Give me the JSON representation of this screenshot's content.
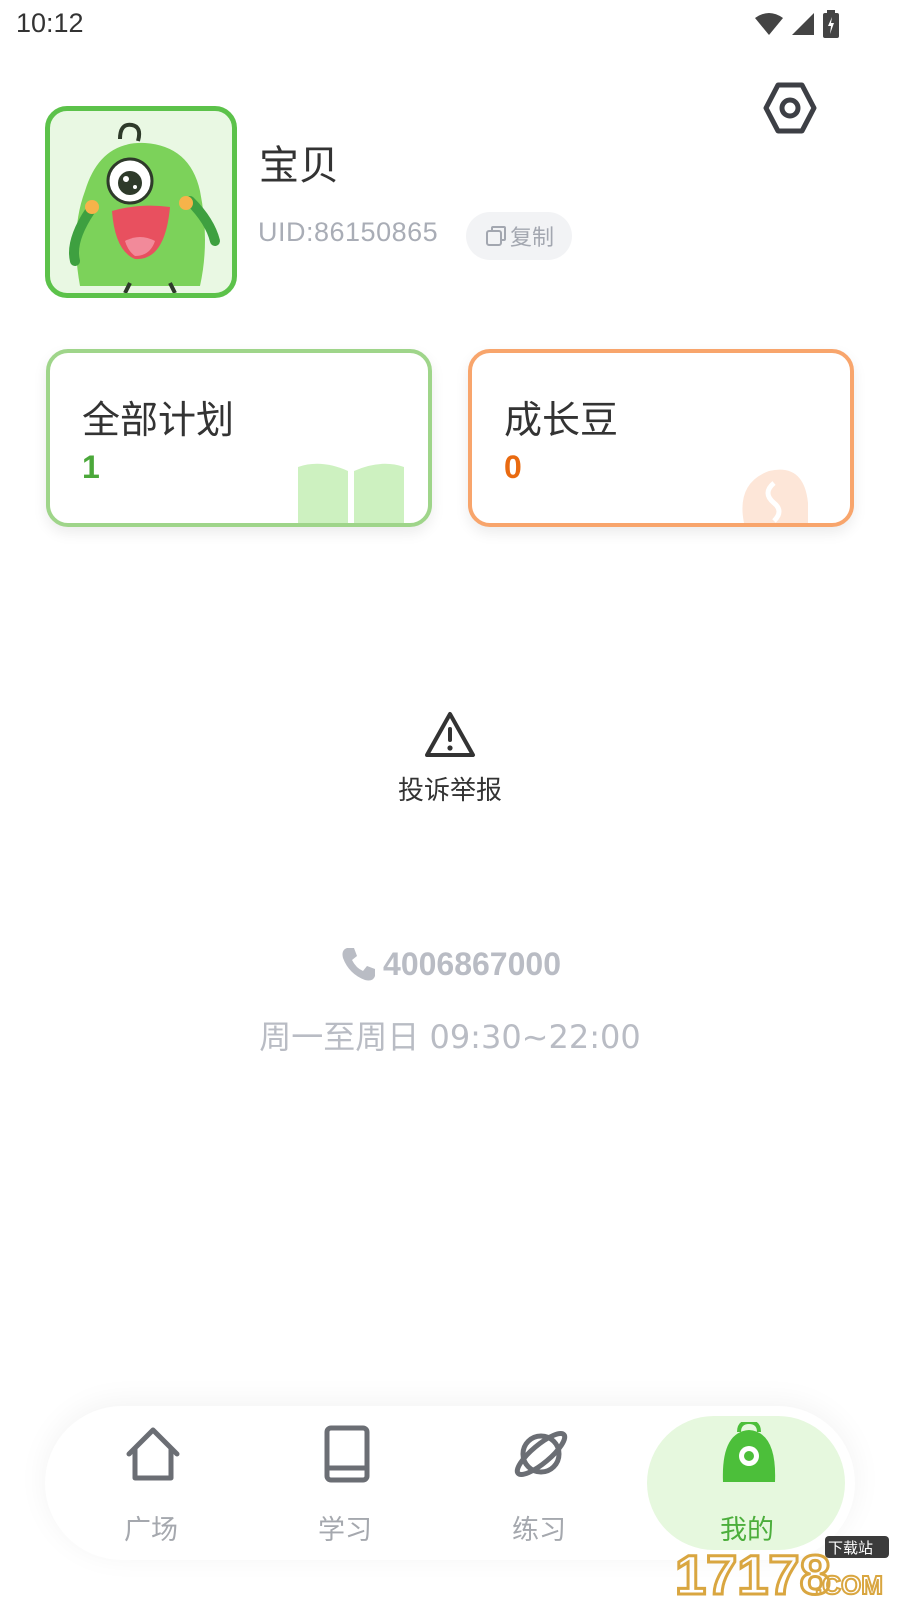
{
  "status_bar": {
    "time": "10:12"
  },
  "profile": {
    "name": "宝贝",
    "uid": "UID:86150865",
    "copy_label": "复制"
  },
  "cards": {
    "plans": {
      "title": "全部计划",
      "value": "1",
      "color": "#4ba83a"
    },
    "beans": {
      "title": "成长豆",
      "value": "0",
      "color": "#e96a10"
    }
  },
  "report": {
    "label": "投诉举报"
  },
  "contact": {
    "phone": "4006867000",
    "hours": "周一至周日 09:30~22:00"
  },
  "nav": {
    "items": [
      {
        "label": "广场",
        "icon": "home-icon"
      },
      {
        "label": "学习",
        "icon": "book-icon"
      },
      {
        "label": "练习",
        "icon": "planet-icon"
      },
      {
        "label": "我的",
        "icon": "monster-icon"
      }
    ],
    "active_index": 3
  },
  "watermark": {
    "text": "17178",
    "suffix": ".COM",
    "tag": "下载站"
  },
  "colors": {
    "accent_green": "#5cc24a",
    "accent_orange": "#f8a56c",
    "muted": "#b9bcc4"
  }
}
